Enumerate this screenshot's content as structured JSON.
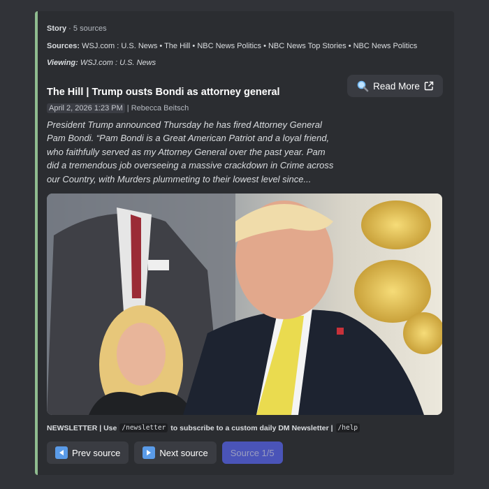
{
  "story": {
    "label": "Story",
    "sep": " · ",
    "count": "5 sources"
  },
  "sources": {
    "label": "Sources:",
    "list": "WSJ.com : U.S. News • The Hill • NBC News Politics • NBC News Top Stories • NBC News Politics"
  },
  "viewing": {
    "label": "Viewing:",
    "value": "WSJ.com : U.S. News"
  },
  "article": {
    "title": "The Hill | Trump ousts Bondi as attorney general",
    "date": "April 2, 2026 1:23 PM",
    "author": "| Rebecca Beitsch",
    "description": "President Trump announced Thursday he has fired Attorney General Pam Bondi. “Pam Bondi is a Great American Patriot and a loyal friend, who faithfully served as my Attorney General over the past year. Pam did a tremendous job overseeing a massive crackdown in Crime across our Country, with Murders plummeting to their lowest level since..."
  },
  "read_more": {
    "label": "Read More",
    "icon": "magnifier-icon",
    "external_icon": "external-link-icon"
  },
  "footer": {
    "prefix": "NEWSLETTER | Use",
    "command": "/newsletter",
    "middle": "to subscribe to a custom daily DM Newsletter |",
    "help": "/help"
  },
  "buttons": {
    "prev": "Prev source",
    "next": "Next source",
    "page": "Source 1/5"
  },
  "colors": {
    "accent_bar": "#8fbc8f",
    "embed_bg": "#2b2d31",
    "page_bg": "#313338",
    "primary_button": "#5865f2"
  }
}
